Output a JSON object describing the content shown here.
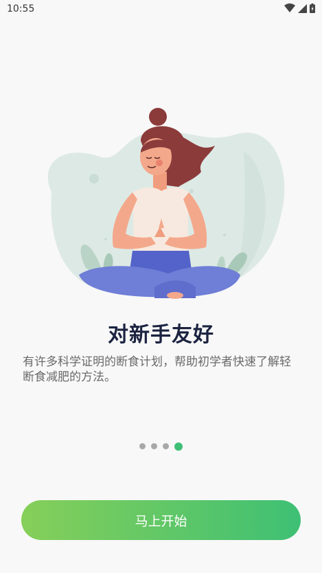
{
  "status_bar": {
    "time": "10:55",
    "icons": [
      "wifi-icon",
      "cell-signal-icon",
      "battery-icon"
    ]
  },
  "onboarding": {
    "title": "对新手友好",
    "description": "有许多科学证明的断食计划，帮助初学者快速了解轻断食减肥的方法。",
    "page_index": 4,
    "page_count": 4,
    "start_button_label": "马上开始"
  },
  "colors": {
    "accent": "#3fbf76",
    "button_gradient_start": "#86cf59",
    "button_gradient_end": "#3ec074",
    "title": "#1b2340",
    "text_secondary": "#6a6a6a",
    "background": "#f8f8f8"
  }
}
